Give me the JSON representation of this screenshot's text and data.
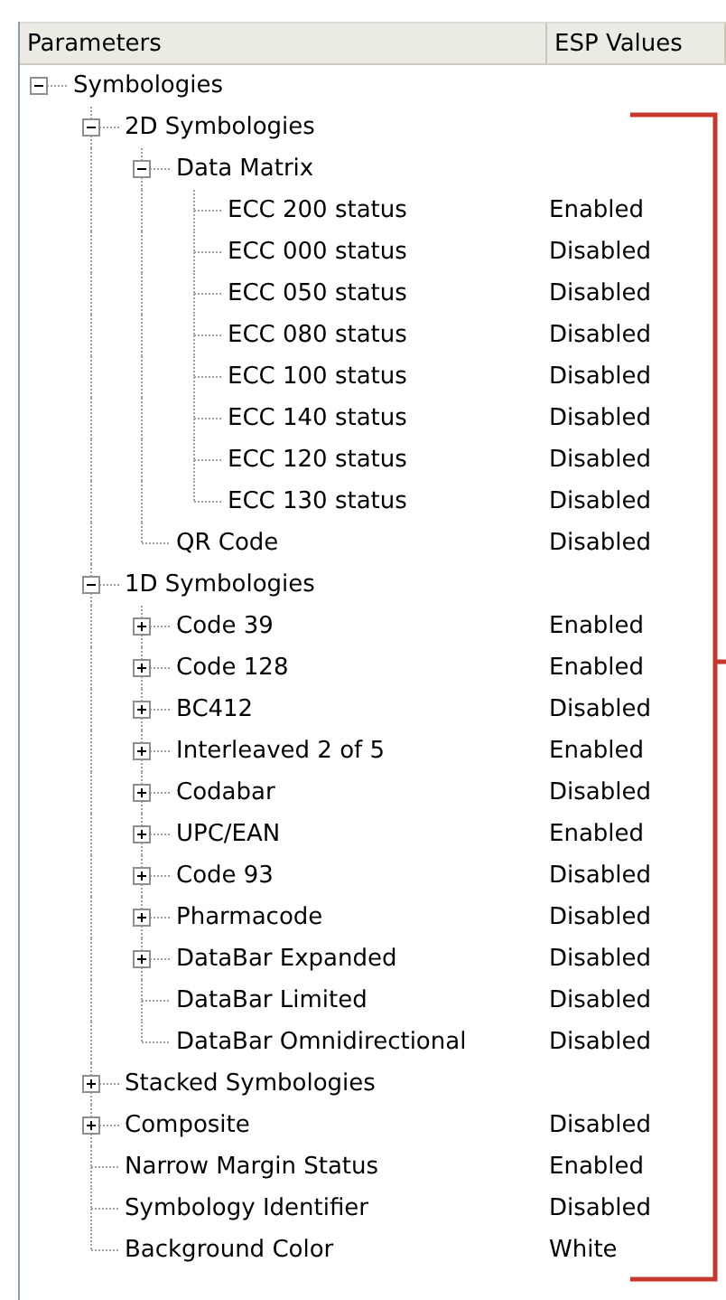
{
  "columns": [
    "Parameters",
    "ESP Values"
  ],
  "tree": [
    {
      "label": "Symbologies",
      "expanded": true,
      "children": [
        {
          "label": "2D Symbologies",
          "expanded": true,
          "children": [
            {
              "label": "Data Matrix",
              "expanded": true,
              "children": [
                {
                  "label": "ECC 200 status",
                  "value": "Enabled"
                },
                {
                  "label": "ECC 000 status",
                  "value": "Disabled"
                },
                {
                  "label": "ECC 050 status",
                  "value": "Disabled"
                },
                {
                  "label": "ECC 080 status",
                  "value": "Disabled"
                },
                {
                  "label": "ECC 100 status",
                  "value": "Disabled"
                },
                {
                  "label": "ECC 140 status",
                  "value": "Disabled"
                },
                {
                  "label": "ECC 120 status",
                  "value": "Disabled"
                },
                {
                  "label": "ECC 130 status",
                  "value": "Disabled"
                }
              ]
            },
            {
              "label": "QR Code",
              "value": "Disabled"
            }
          ]
        },
        {
          "label": "1D Symbologies",
          "expanded": true,
          "children": [
            {
              "label": "Code 39",
              "value": "Enabled",
              "expanded": false
            },
            {
              "label": "Code 128",
              "value": "Enabled",
              "expanded": false
            },
            {
              "label": "BC412",
              "value": "Disabled",
              "expanded": false
            },
            {
              "label": "Interleaved 2 of 5",
              "value": "Enabled",
              "expanded": false
            },
            {
              "label": "Codabar",
              "value": "Disabled",
              "expanded": false
            },
            {
              "label": "UPC/EAN",
              "value": "Enabled",
              "expanded": false
            },
            {
              "label": "Code 93",
              "value": "Disabled",
              "expanded": false
            },
            {
              "label": "Pharmacode",
              "value": "Disabled",
              "expanded": false
            },
            {
              "label": "DataBar Expanded",
              "value": "Disabled",
              "expanded": false
            },
            {
              "label": "DataBar Limited",
              "value": "Disabled"
            },
            {
              "label": "DataBar Omnidirectional",
              "value": "Disabled"
            }
          ]
        },
        {
          "label": "Stacked Symbologies",
          "expanded": false
        },
        {
          "label": "Composite",
          "value": "Disabled",
          "expanded": false
        },
        {
          "label": "Narrow Margin Status",
          "value": "Enabled"
        },
        {
          "label": "Symbology Identifier",
          "value": "Disabled"
        },
        {
          "label": "Background Color",
          "value": "White"
        }
      ]
    }
  ]
}
